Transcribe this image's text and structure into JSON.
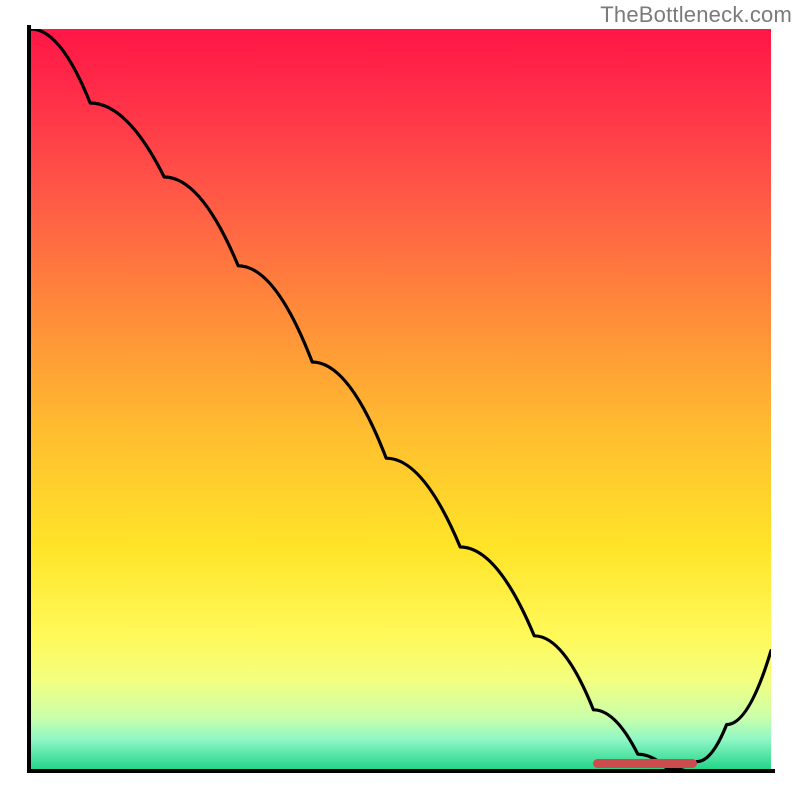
{
  "watermark": "TheBottleneck.com",
  "chart_data": {
    "type": "line",
    "title": "",
    "xlabel": "",
    "ylabel": "",
    "xlim": [
      0,
      100
    ],
    "ylim": [
      0,
      100
    ],
    "curve": {
      "name": "bottleneck-curve",
      "x": [
        0,
        8,
        18,
        28,
        38,
        48,
        58,
        68,
        76,
        82,
        86,
        90,
        94,
        100
      ],
      "y": [
        100,
        90,
        80,
        68,
        55,
        42,
        30,
        18,
        8,
        2,
        0,
        1,
        6,
        16
      ]
    },
    "highlight_segment": {
      "x_start": 76,
      "x_end": 90,
      "y": 0.8
    },
    "gradient_stops": [
      {
        "pos": 0,
        "color": "#ff1646"
      },
      {
        "pos": 22,
        "color": "#ff5747"
      },
      {
        "pos": 55,
        "color": "#ffbf2f"
      },
      {
        "pos": 82,
        "color": "#fff95a"
      },
      {
        "pos": 100,
        "color": "#24d58a"
      }
    ]
  }
}
